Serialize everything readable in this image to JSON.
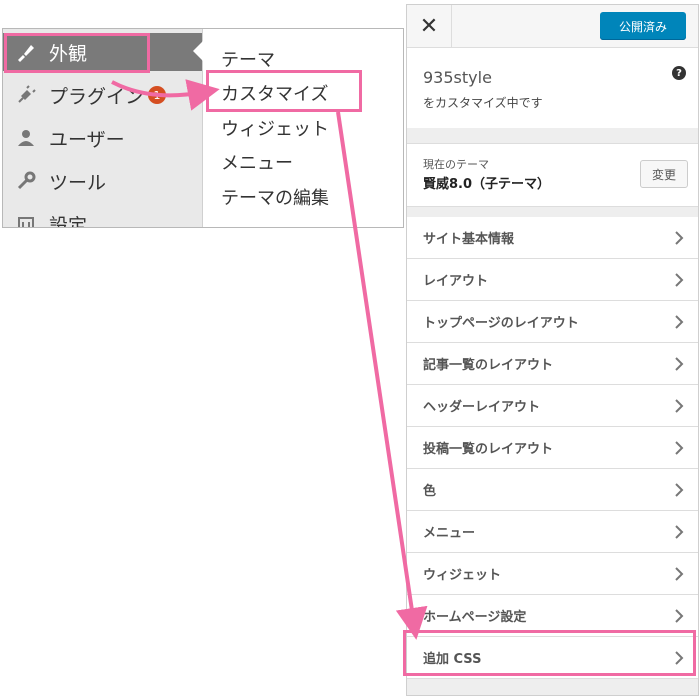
{
  "admin_menu": {
    "items": [
      {
        "label": "外観",
        "icon": "paintbrush-icon",
        "active": true
      },
      {
        "label": "プラグイン",
        "icon": "plugin-icon",
        "badge": "1"
      },
      {
        "label": "ユーザー",
        "icon": "user-icon"
      },
      {
        "label": "ツール",
        "icon": "wrench-icon"
      },
      {
        "label": "設定",
        "icon": "settings-icon"
      }
    ],
    "submenu": [
      "テーマ",
      "カスタマイズ",
      "ウィジェット",
      "メニュー",
      "テーマの編集"
    ]
  },
  "customizer": {
    "close_icon": "close-icon",
    "publish_label": "公開済み",
    "site_title": "935style",
    "site_subtitle": "をカスタマイズ中です",
    "help_icon": "help-icon",
    "theme_label": "現在のテーマ",
    "theme_name": "賢威8.0（子テーマ）",
    "change_label": "変更",
    "sections": [
      "サイト基本情報",
      "レイアウト",
      "トップページのレイアウト",
      "記事一覧のレイアウト",
      "ヘッダーレイアウト",
      "投稿一覧のレイアウト",
      "色",
      "メニュー",
      "ウィジェット",
      "ホームページ設定",
      "追加 CSS"
    ]
  },
  "colors": {
    "highlight": "#f06aa3",
    "publish": "#0085ba",
    "badge": "#d54e21",
    "active_menu": "#7a7a7a"
  }
}
